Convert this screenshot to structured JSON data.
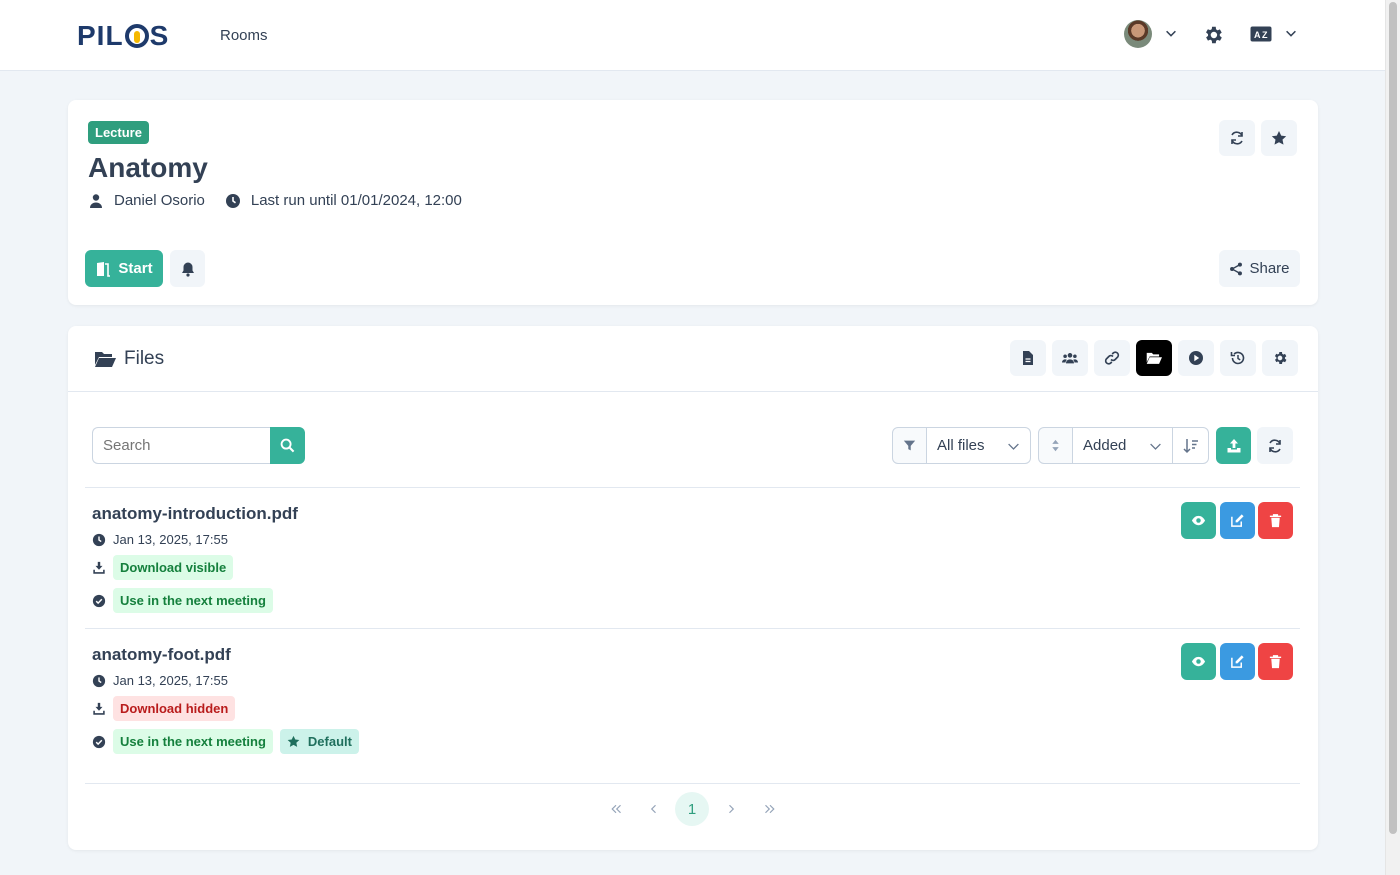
{
  "navbar": {
    "logo": "PILOS",
    "rooms_link": "Rooms"
  },
  "room": {
    "badge": "Lecture",
    "title": "Anatomy",
    "owner": "Daniel Osorio",
    "last_run": "Last run until 01/01/2024, 12:00",
    "start_label": "Start",
    "share_label": "Share"
  },
  "files": {
    "title": "Files",
    "search_placeholder": "Search",
    "filter_value": "All files",
    "sort_value": "Added",
    "items": [
      {
        "name": "anatomy-introduction.pdf",
        "date": "Jan 13, 2025, 17:55",
        "download_tag": "Download visible",
        "use_tag": "Use in the next meeting",
        "default_tag": ""
      },
      {
        "name": "anatomy-foot.pdf",
        "date": "Jan 13, 2025, 17:55",
        "download_tag": "Download hidden",
        "use_tag": "Use in the next meeting",
        "default_tag": "Default"
      }
    ]
  },
  "pagination": {
    "current_page": "1"
  },
  "colors": {
    "primary": "#36b29a",
    "badge": "#2f9e7e",
    "edit": "#3b9ae1",
    "delete": "#ef4444"
  },
  "icons": [
    "user-icon",
    "clock-icon",
    "refresh-icon",
    "star-icon",
    "door-icon",
    "bell-icon",
    "share-icon",
    "folder-open-icon",
    "file-icon",
    "users-icon",
    "link-icon",
    "play-icon",
    "history-icon",
    "gear-icon",
    "search-icon",
    "filter-icon",
    "sort-icon",
    "sort-desc-icon",
    "upload-icon",
    "eye-icon",
    "edit-icon",
    "trash-icon",
    "download-icon",
    "check-circle-icon"
  ]
}
